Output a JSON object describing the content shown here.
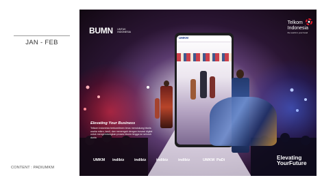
{
  "side_panel": {
    "period": "JAN - FEB",
    "content_credit": "CONTENT : PADIUMKM"
  },
  "poster": {
    "bumn_logo": {
      "word": "BUMN",
      "sub_line1": "UNTUK",
      "sub_line2": "INDONESIA"
    },
    "telkom_logo": {
      "name_line1": "Telkom",
      "name_line2": "Indonesia",
      "tagline": "the world in your hand"
    },
    "app_screen_logo": "UMKM",
    "slogan_title": "Elevating Your Business",
    "slogan_body": "Telkom Indonesia berkomitmen terus mendukung bisnis usaha mikro, kecil, dan menengah dengan inovasi digital untuk mengembangkan proses bisnis hingga ke seluruh dunia",
    "partners": [
      "UMKM",
      "indibiz",
      "indibiz",
      "indibiz",
      "indibiz",
      "UMKM",
      "PaDi"
    ],
    "elevating_line1": "Elevating",
    "elevating_line2": "YourFuture"
  },
  "colors": {
    "stage_red": "#ff2836",
    "stage_blue": "#466eff",
    "telkom_red": "#e4202d"
  }
}
